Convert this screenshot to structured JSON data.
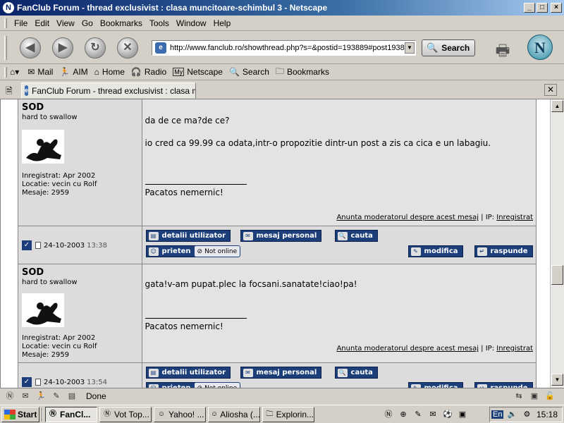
{
  "window": {
    "title": "FanClub Forum - thread exclusivist : clasa muncitoare-schimbul 3 - Netscape",
    "controls": [
      "_",
      "□",
      "×"
    ]
  },
  "menu": [
    "File",
    "Edit",
    "View",
    "Go",
    "Bookmarks",
    "Tools",
    "Window",
    "Help"
  ],
  "nav": {
    "url": "http://www.fanclub.ro/showthread.php?s=&postid=193889#post1938",
    "search_label": "Search"
  },
  "personal_toolbar": [
    {
      "label": "Mail",
      "icon": "mail-icon"
    },
    {
      "label": "AIM",
      "icon": "aim-icon"
    },
    {
      "label": "Home",
      "icon": "home-icon"
    },
    {
      "label": "Radio",
      "icon": "radio-icon"
    },
    {
      "label": "Netscape",
      "icon": "my-netscape-icon"
    },
    {
      "label": "Search",
      "icon": "search-icon"
    },
    {
      "label": "Bookmarks",
      "icon": "bookmarks-folder-icon"
    }
  ],
  "tab": {
    "title": "FanClub Forum - thread exclusivist : clasa m..."
  },
  "posts": [
    {
      "user": {
        "name": "SOD",
        "title": "hard to swallow",
        "registered": "Inregistrat: Apr 2002",
        "location": "Locatie: vecin cu Rolf",
        "messages": "Mesaje: 2959"
      },
      "message_lines": [
        "da de ce ma?de ce?",
        "",
        "io cred ca 99.99 ca odata,intr-o propozitie dintr-un post a zis ca cica e un labagiu."
      ],
      "signature": "Pacatos nemernic!",
      "report_link": "Anunta moderatorul despre acest mesaj",
      "ip_label": " | IP: ",
      "ip_link": "Inregistrat",
      "date": "24-10-2003",
      "time": "13:38"
    },
    {
      "user": {
        "name": "SOD",
        "title": "hard to swallow",
        "registered": "Inregistrat: Apr 2002",
        "location": "Locatie: vecin cu Rolf",
        "messages": "Mesaje: 2959"
      },
      "message_lines": [
        "gata!v-am pupat.plec la focsani.sanatate!ciao!pa!"
      ],
      "signature": "Pacatos nemernic!",
      "report_link": "Anunta moderatorul despre acest mesaj",
      "ip_label": " | IP: ",
      "ip_link": "Inregistrat",
      "date": "24-10-2003",
      "time": "13:54"
    }
  ],
  "post_buttons": {
    "details": "detalii utilizator",
    "pm": "mesaj personal",
    "search": "cauta",
    "friend": "prieten",
    "status": "Not online",
    "edit": "modifica",
    "reply": "raspunde"
  },
  "status": {
    "text": "Done"
  },
  "taskbar": {
    "start": "Start",
    "tasks": [
      "FanCl...",
      "Vot Top...",
      "Yahoo! ...",
      "Aliosha (...",
      "Explorin..."
    ],
    "lang": "En",
    "clock": "15:18"
  }
}
